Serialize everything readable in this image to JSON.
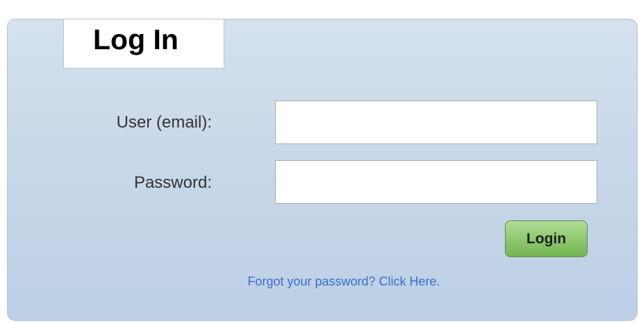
{
  "login": {
    "title": "Log In",
    "email_label": "User (email):",
    "email_value": "",
    "password_label": "Password:",
    "password_value": "",
    "submit_label": "Login",
    "forgot_text": "Forgot your password? ",
    "forgot_link_label": "Click Here",
    "forgot_trailing": "."
  },
  "colors": {
    "panel_top": "#d5e1ee",
    "panel_bottom": "#bccfe5",
    "button_green": "#8fc96f",
    "link_blue": "#3a6fd0"
  }
}
